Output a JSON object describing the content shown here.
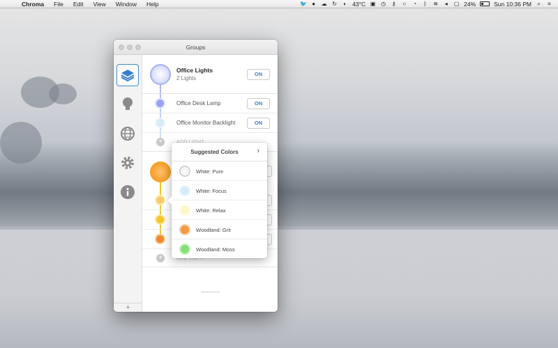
{
  "menubar": {
    "app_name": "Chroma",
    "menus": [
      "File",
      "Edit",
      "View",
      "Window",
      "Help"
    ],
    "temperature": "43°C",
    "battery": "24%",
    "clock": "Sun 10:36 PM"
  },
  "window": {
    "title": "Groups",
    "sidebar": {
      "items": [
        {
          "icon": "layers-icon",
          "active": true
        },
        {
          "icon": "lightbulb-icon",
          "active": false
        },
        {
          "icon": "globe-icon",
          "active": false
        },
        {
          "icon": "gear-icon",
          "active": false
        },
        {
          "icon": "info-icon",
          "active": false
        }
      ],
      "add_label": "+"
    },
    "groups": [
      {
        "name": "Office Lights",
        "subtitle": "2 Lights",
        "toggle": "ON",
        "lights": [
          {
            "name": "Office Desk Lamp",
            "toggle": "ON",
            "color": "#9aa4ee"
          },
          {
            "name": "Office Monitor Backlight",
            "toggle": "ON",
            "color": "#d6ecf8"
          }
        ],
        "add_light": "ADD LIGHT"
      },
      {
        "name": "",
        "add_light": "ADD LIGHT"
      }
    ]
  },
  "popover": {
    "title": "Suggested Colors",
    "items": [
      {
        "label": "White: Pure",
        "color": "#ffffff"
      },
      {
        "label": "White: Focus",
        "color": "#d4ecfa"
      },
      {
        "label": "White: Relax",
        "color": "#fdf6c8"
      },
      {
        "label": "Woodland: Grit",
        "color": "#f59a44"
      },
      {
        "label": "Woodland: Moss",
        "color": "#86e07a"
      }
    ]
  },
  "colors": {
    "accent": "#3a7fcf",
    "group1_ring": "#a9b2f3",
    "group2_ring": "#f5a623",
    "group2_line": "#f2c232"
  }
}
